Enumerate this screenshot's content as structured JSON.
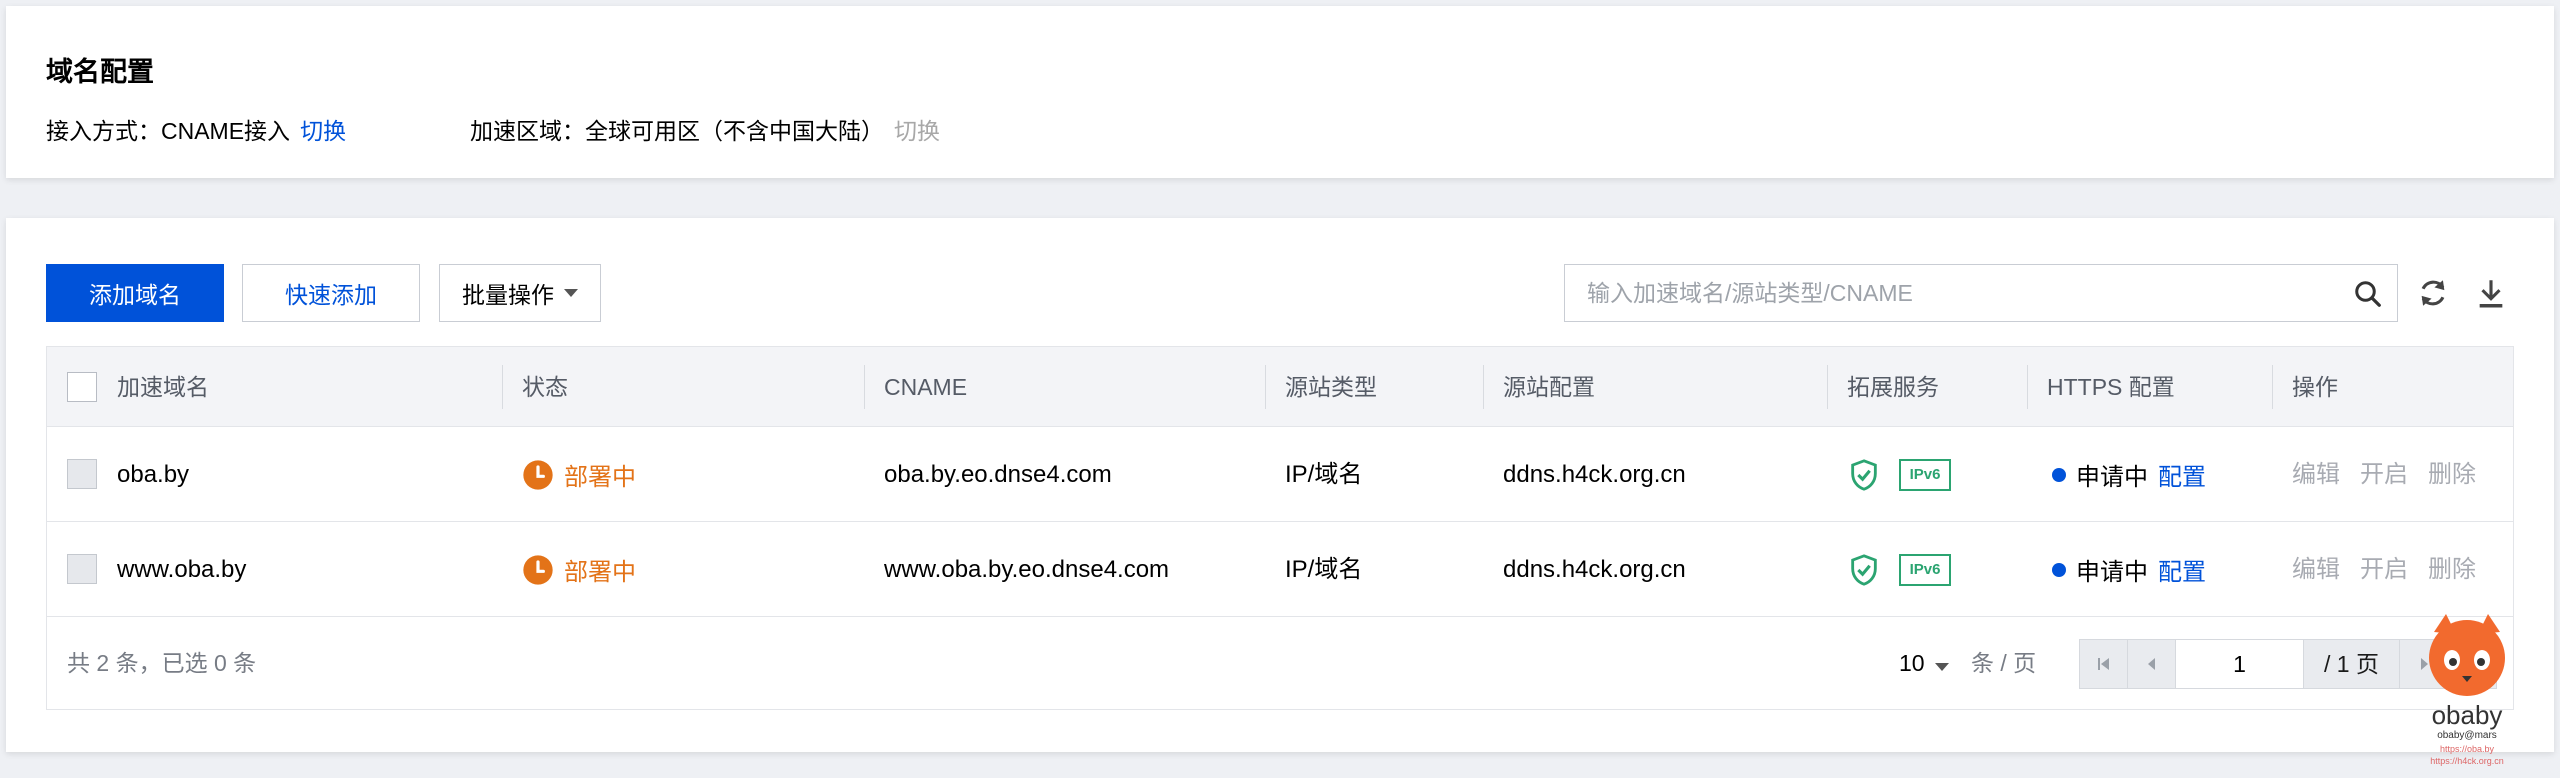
{
  "config": {
    "title": "域名配置",
    "access_label": "接入方式：CNAME接入",
    "access_switch": "切换",
    "region_label": "加速区域：全球可用区（不含中国大陆）",
    "region_switch": "切换"
  },
  "toolbar": {
    "add_label": "添加域名",
    "quick_label": "快速添加",
    "batch_label": "批量操作",
    "search_placeholder": "输入加速域名/源站类型/CNAME"
  },
  "table": {
    "headers": [
      "加速域名",
      "状态",
      "CNAME",
      "源站类型",
      "源站配置",
      "拓展服务",
      "HTTPS 配置",
      "操作"
    ],
    "rows": [
      {
        "domain": "oba.by",
        "status": "部署中",
        "cname": "oba.by.eo.dnse4.com",
        "origin_type": "IP/域名",
        "origin_config": "ddns.h4ck.org.cn",
        "ext_badge": "IPv6",
        "https_status": "申请中",
        "https_action": "配置",
        "ops": [
          "编辑",
          "开启",
          "删除"
        ]
      },
      {
        "domain": "www.oba.by",
        "status": "部署中",
        "cname": "www.oba.by.eo.dnse4.com",
        "origin_type": "IP/域名",
        "origin_config": "ddns.h4ck.org.cn",
        "ext_badge": "IPv6",
        "https_status": "申请中",
        "https_action": "配置",
        "ops": [
          "编辑",
          "开启",
          "删除"
        ]
      }
    ]
  },
  "footer": {
    "total": "共 2 条，已选 0 条",
    "page_size": "10",
    "per_page": "条 / 页",
    "current_page": "1",
    "total_pages": "/ 1 页"
  },
  "watermark": {
    "name": "obaby",
    "sub": "obaby@mars",
    "url1": "https://oba.by",
    "url2": "https://h4ck.org.cn"
  },
  "colors": {
    "primary": "#0052d9",
    "warning": "#e37318",
    "success": "#2ba471",
    "muted": "#a8abb2"
  }
}
